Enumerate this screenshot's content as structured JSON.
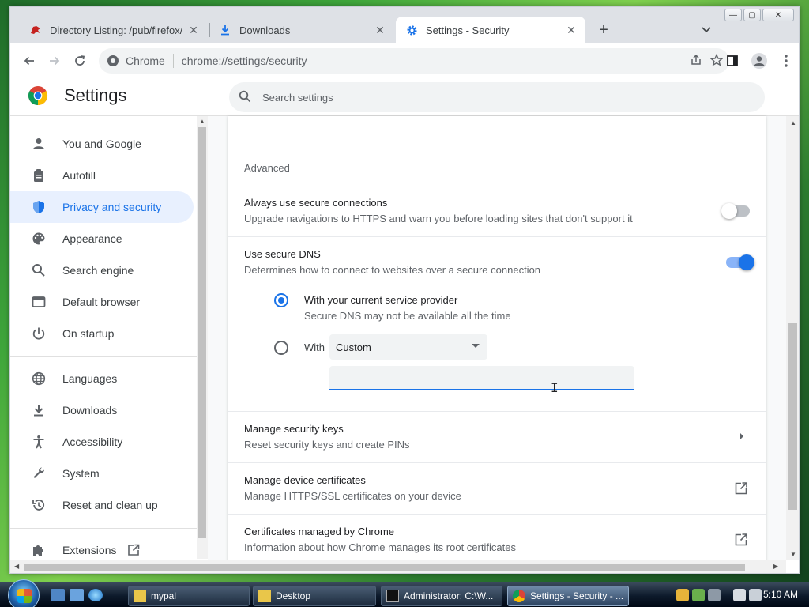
{
  "tabs": [
    {
      "title": "Directory Listing: /pub/firefox/re",
      "icon": "mozilla-dino-icon"
    },
    {
      "title": "Downloads",
      "icon": "download-icon"
    },
    {
      "title": "Settings - Security",
      "icon": "gear-icon"
    }
  ],
  "omnibox": {
    "chip": "Chrome",
    "url": "chrome://settings/security"
  },
  "header": {
    "title": "Settings",
    "search_placeholder": "Search settings"
  },
  "sidebar": {
    "items": [
      {
        "label": "You and Google",
        "icon": "person-icon"
      },
      {
        "label": "Autofill",
        "icon": "clipboard-icon"
      },
      {
        "label": "Privacy and security",
        "icon": "shield-icon"
      },
      {
        "label": "Appearance",
        "icon": "palette-icon"
      },
      {
        "label": "Search engine",
        "icon": "search-icon"
      },
      {
        "label": "Default browser",
        "icon": "browser-icon"
      },
      {
        "label": "On startup",
        "icon": "power-icon"
      },
      {
        "label": "Languages",
        "icon": "globe-icon"
      },
      {
        "label": "Downloads",
        "icon": "download-icon"
      },
      {
        "label": "Accessibility",
        "icon": "accessibility-icon"
      },
      {
        "label": "System",
        "icon": "wrench-icon"
      },
      {
        "label": "Reset and clean up",
        "icon": "history-icon"
      }
    ],
    "extensions_label": "Extensions"
  },
  "content": {
    "section_title": "Advanced",
    "https_only": {
      "title": "Always use secure connections",
      "sub": "Upgrade navigations to HTTPS and warn you before loading sites that don't support it",
      "enabled": false
    },
    "secure_dns": {
      "title": "Use secure DNS",
      "sub": "Determines how to connect to websites over a secure connection",
      "enabled": true
    },
    "dns_option1": {
      "title": "With your current service provider",
      "sub": "Secure DNS may not be available all the time"
    },
    "dns_option2": {
      "label": "With",
      "select_value": "Custom",
      "input_value": ""
    },
    "security_keys": {
      "title": "Manage security keys",
      "sub": "Reset security keys and create PINs"
    },
    "device_certs": {
      "title": "Manage device certificates",
      "sub": "Manage HTTPS/SSL certificates on your device"
    },
    "chrome_certs": {
      "title": "Certificates managed by Chrome",
      "sub": "Information about how Chrome manages its root certificates"
    }
  },
  "taskbar": {
    "buttons": [
      {
        "label": "mypal"
      },
      {
        "label": "Desktop"
      },
      {
        "label": "Administrator: C:\\W..."
      },
      {
        "label": "Settings - Security - ..."
      }
    ],
    "clock": "5:10 AM"
  },
  "colors": {
    "accent": "#1a73e8",
    "active_nav_bg": "#e8f0fe"
  }
}
